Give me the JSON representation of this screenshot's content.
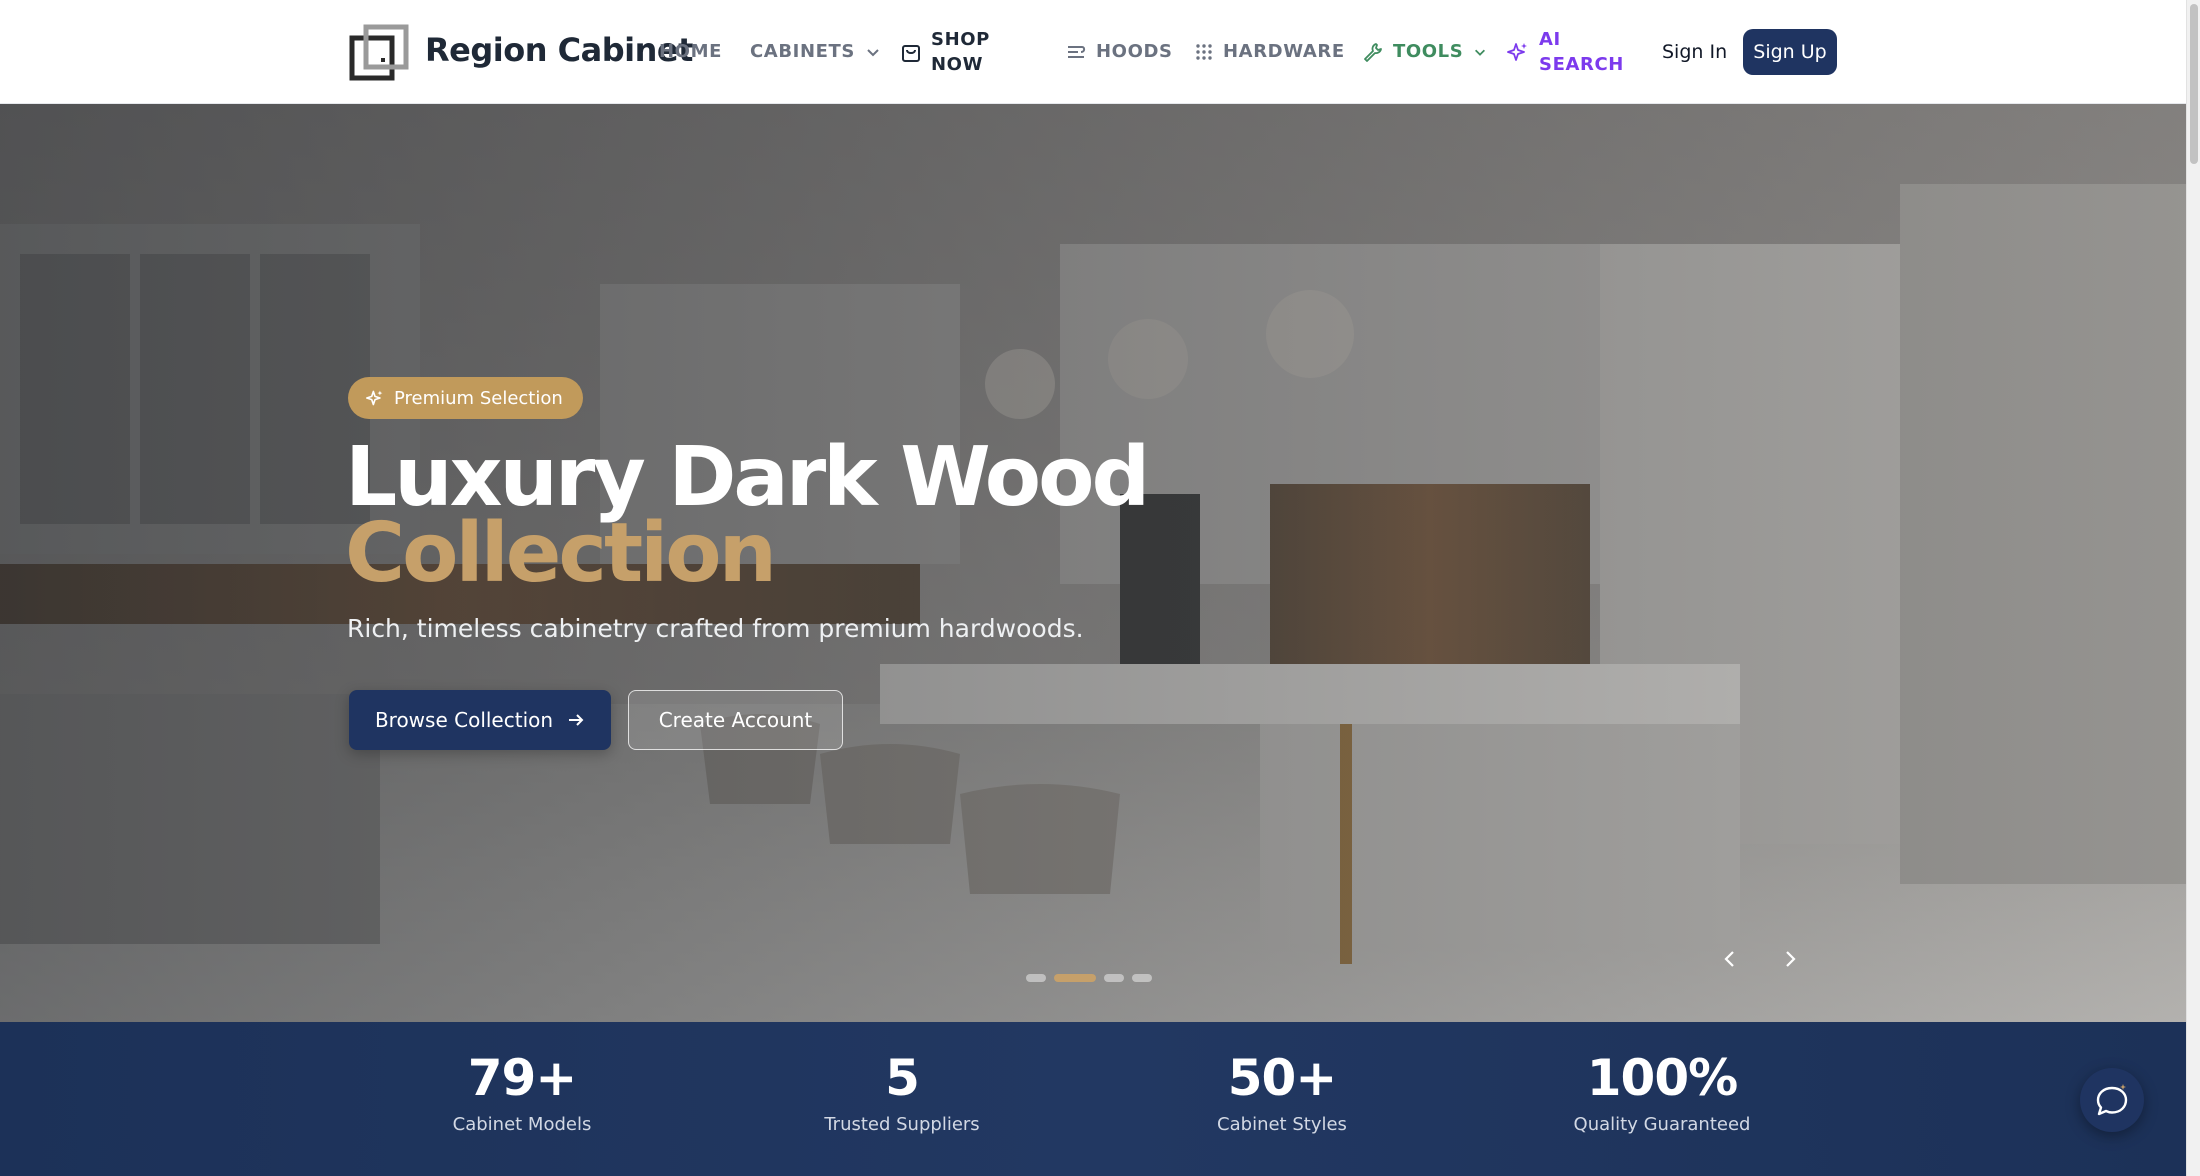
{
  "nav": {
    "brand": "Region Cabinet",
    "items": {
      "home": "HOME",
      "cabinets": "CABINETS",
      "shop_line1": "SHOP",
      "shop_line2": "NOW",
      "hoods": "HOODS",
      "hardware": "HARDWARE",
      "tools": "TOOLS",
      "ai_line1": "AI",
      "ai_line2": "SEARCH"
    },
    "sign_in": "Sign In",
    "sign_up": "Sign Up"
  },
  "hero": {
    "badge": "Premium Selection",
    "title_line1": "Luxury Dark Wood",
    "title_line2": "Collection",
    "subtitle": "Rich, timeless cabinetry crafted from premium hardwoods.",
    "primary_button": "Browse Collection",
    "secondary_button": "Create Account",
    "slides_total": 4,
    "active_slide": 2
  },
  "stats": [
    {
      "value": "79+",
      "label": "Cabinet Models"
    },
    {
      "value": "5",
      "label": "Trusted Suppliers"
    },
    {
      "value": "50+",
      "label": "Cabinet Styles"
    },
    {
      "value": "100%",
      "label": "Quality Guaranteed"
    }
  ],
  "colors": {
    "navy": "#1f3461",
    "gold": "#c6a06a",
    "tools_green": "#3f8c5f",
    "ai_purple": "#7c3aed"
  },
  "icons": [
    "logo-icon",
    "chevron-down-icon",
    "shopping-bag-icon",
    "hood-icon",
    "grid-icon",
    "wrench-icon",
    "sparkles-icon",
    "arrow-right-icon",
    "chevron-left-icon",
    "chevron-right-icon",
    "chat-icon"
  ]
}
